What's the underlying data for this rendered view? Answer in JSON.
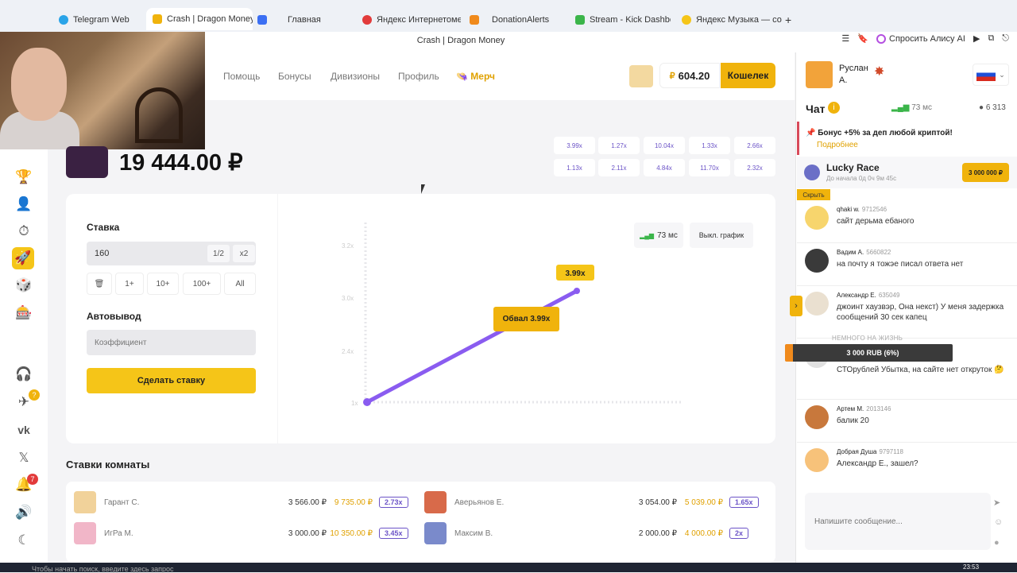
{
  "browser": {
    "tabs": [
      {
        "label": "Telegram Web",
        "color": "#2aa4e8"
      },
      {
        "label": "Crash | Dragon Money",
        "color": "#f0b30c",
        "active": true
      },
      {
        "label": "Главная",
        "color": "#3b6ff3"
      },
      {
        "label": "Яндекс Интернетометр –",
        "color": "#e23b3b"
      },
      {
        "label": "DonationAlerts",
        "color": "#f08a1c"
      },
      {
        "label": "Stream - Kick Dashboard",
        "color": "#3bb54a"
      },
      {
        "label": "Яндекс Музыка — собир",
        "color": "#f5c518"
      }
    ],
    "page_title": "Crash | Dragon Money",
    "alice": "Спросить Алису AI"
  },
  "nav": {
    "items": [
      "Помощь",
      "Бонусы",
      "Дивизионы",
      "Профиль"
    ],
    "merch": "Мерч",
    "balance": "604.20",
    "currency": "₽",
    "wallet": "Кошелек",
    "tg_badge": "?",
    "notif_badge": "7"
  },
  "game": {
    "total": "19 444.00 ₽",
    "history": [
      "3.99x",
      "1.27x",
      "10.04x",
      "1.33x",
      "2.66x",
      "1.13x",
      "2.11x",
      "4.84x",
      "11.70x",
      "2.32x"
    ],
    "history_colors": [
      "#6b53c7",
      "#6b53c7",
      "#6b53c7",
      "#6b53c7",
      "#6b53c7",
      "#6b53c7",
      "#6b53c7",
      "#6b53c7",
      "#6b53c7",
      "#6b53c7"
    ]
  },
  "bet": {
    "stake_label": "Ставка",
    "stake_value": "160",
    "half": "1/2",
    "double": "x2",
    "quick": [
      "1+",
      "10+",
      "100+",
      "All"
    ],
    "auto_label": "Автовывод",
    "coef_placeholder": "Коэффициент",
    "make_bet": "Сделать ставку"
  },
  "graph": {
    "ping": "73 мс",
    "off_graph": "Выкл. график",
    "crash_label": "Обвал 3.99x",
    "current": "3.99x",
    "y_ticks": [
      "3.2x",
      "3.0x",
      "2.4x",
      "1x"
    ]
  },
  "room": {
    "title": "Ставки комнаты",
    "bets": [
      {
        "name": "Гарант С.",
        "amount": "3 566.00 ₽",
        "win": "9 735.00 ₽",
        "mult": "2.73x"
      },
      {
        "name": "Аверьянов Е.",
        "amount": "3 054.00 ₽",
        "win": "5 039.00 ₽",
        "mult": "1.65x"
      },
      {
        "name": "ИгРа М.",
        "amount": "3 000.00 ₽",
        "win": "10 350.00 ₽",
        "mult": "3.45x"
      },
      {
        "name": "Максим В.",
        "amount": "2 000.00 ₽",
        "win": "4 000.00 ₽",
        "mult": "2x"
      }
    ]
  },
  "chat": {
    "user_name": "Руслан",
    "user_sub": "А.",
    "title": "Чат",
    "ping": "73 мс",
    "online": "6 313",
    "promo_text": "Бонус +5% за деп любой криптой!",
    "promo_link": "Подробнее",
    "lucky_title": "Lucky Race",
    "lucky_sub": "До начала 0д 0ч 9м 45с",
    "lucky_amount": "3 000 000 ₽",
    "hide": "Скрыть",
    "toast_caption": "НЕМНОГО НА ЖИЗНЬ",
    "toast": "3 000 RUB (6%)",
    "input_placeholder": "Напишите сообщение...",
    "messages": [
      {
        "name": "qhaki w.",
        "id": "9712546",
        "text": "сайт дерьма ебаного"
      },
      {
        "name": "Вадим А.",
        "id": "5660822",
        "text": "на почту я тожэе писал ответа нет"
      },
      {
        "name": "Александр Е.",
        "id": "635049",
        "text": "джоинт хаузвэр, Она некст) У меня задержка сообщений 30 сек капец"
      },
      {
        "name": "",
        "id": "",
        "text": "СТОрублей Убытка, на сайте нет откруток 🤔"
      },
      {
        "name": "Артем М.",
        "id": "2013146",
        "text": "балик 20"
      },
      {
        "name": "Добрая Душа",
        "id": "9797118",
        "text": "Александр Е., зашел?"
      }
    ]
  },
  "taskbar": {
    "search": "Чтобы начать поиск, введите здесь запрос",
    "time": "23:53"
  }
}
